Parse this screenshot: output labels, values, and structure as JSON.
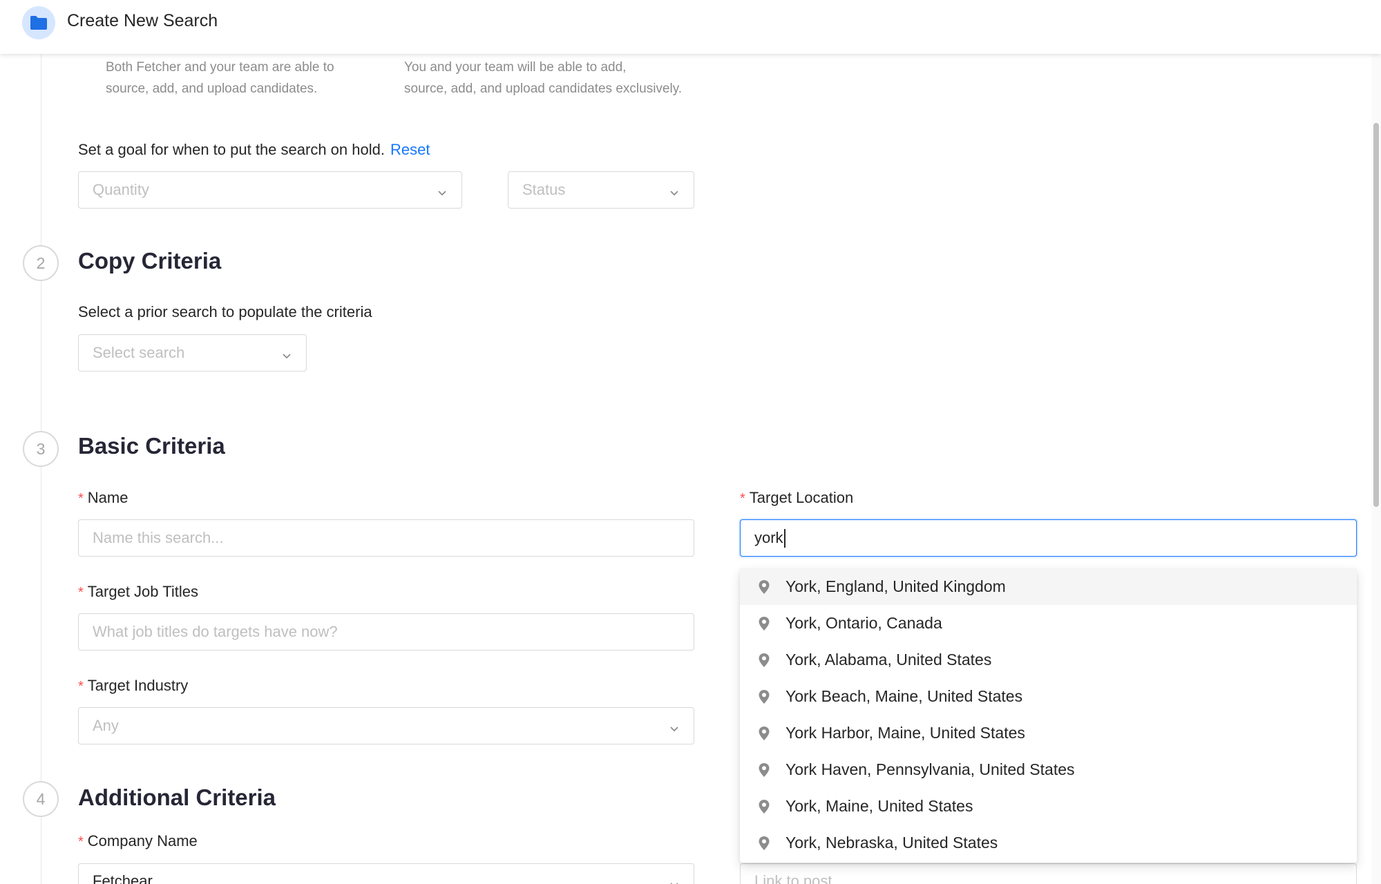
{
  "header": {
    "title": "Create New Search",
    "icon": "folder-icon"
  },
  "step1": {
    "option_left_desc": [
      "Both Fetcher and your team are able to",
      "source, add, and upload candidates."
    ],
    "option_right_desc": [
      "You and your team will be able to add,",
      "source, add, and upload candidates exclusively."
    ],
    "goal_text": "Set a goal for when to put the search on hold.",
    "reset_link": "Reset",
    "quantity_placeholder": "Quantity",
    "status_placeholder": "Status"
  },
  "step2": {
    "number": "2",
    "title": "Copy Criteria",
    "description": "Select a prior search to populate the criteria",
    "select_placeholder": "Select search"
  },
  "step3": {
    "number": "3",
    "title": "Basic Criteria",
    "name_label": "Name",
    "name_placeholder": "Name this search...",
    "location_label": "Target Location",
    "location_value": "york",
    "job_titles_label": "Target Job Titles",
    "job_titles_placeholder": "What job titles do targets have now?",
    "industry_label": "Target Industry",
    "industry_value": "Any"
  },
  "step4": {
    "number": "4",
    "title": "Additional Criteria",
    "company_label": "Company Name",
    "company_value": "Fetchear",
    "link_placeholder": "Link to post"
  },
  "location_suggestions": [
    "York, England, United Kingdom",
    "York, Ontario, Canada",
    "York, Alabama, United States",
    "York Beach, Maine, United States",
    "York Harbor, Maine, United States",
    "York Haven, Pennsylvania, United States",
    "York, Maine, United States",
    "York, Nebraska, United States"
  ],
  "colors": {
    "accent": "#1677ff",
    "required": "#ff4d4f",
    "badge_bg": "#d6e6ff"
  }
}
